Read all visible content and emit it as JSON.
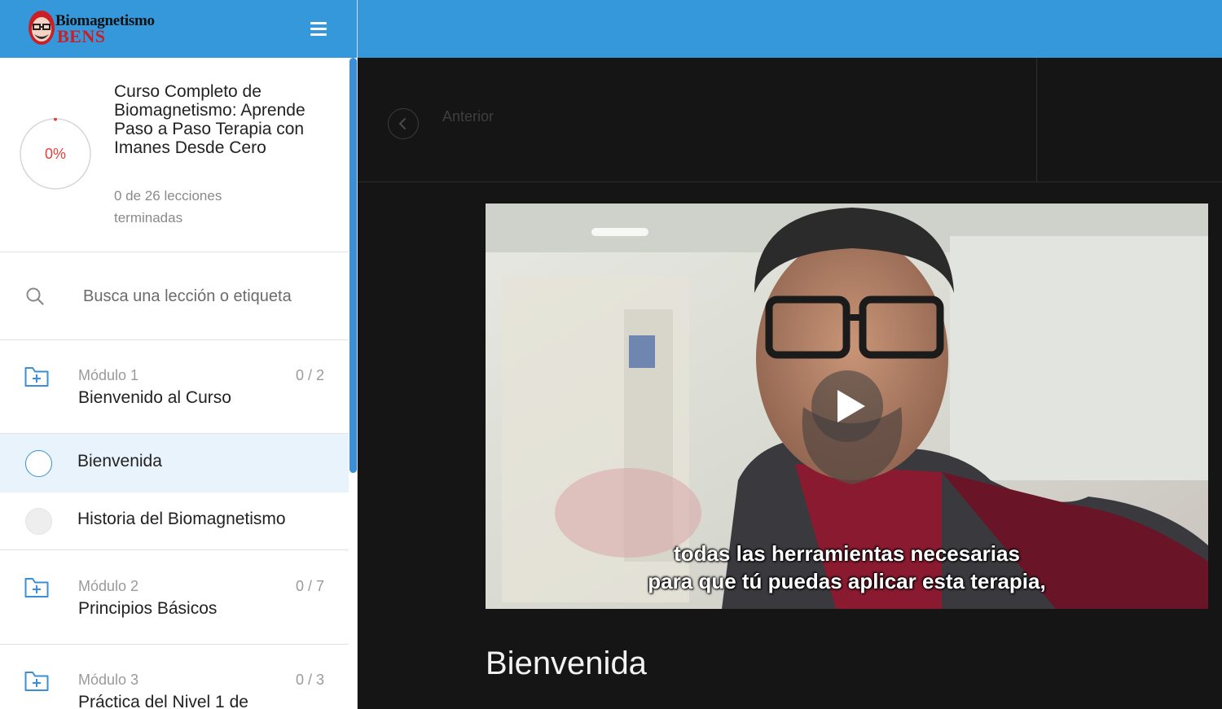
{
  "brand": {
    "line1": "Biomagnetismo",
    "line2": "BENS",
    "header_color": "#3498db",
    "accent_red": "#e0403a"
  },
  "course": {
    "progress_percent": "0%",
    "progress_value": 0,
    "title": "Curso Completo de Biomagnetismo: Aprende Paso a Paso Terapia con Imanes Desde Cero",
    "lessons_done": "0 de 26 lecciones terminadas"
  },
  "search": {
    "placeholder": "Busca una lección o etiqueta",
    "icon": "search-icon"
  },
  "modules": [
    {
      "number": "Módulo 1",
      "title": "Bienvenido al Curso",
      "count": "0 / 2",
      "icon": "folder-plus-icon"
    },
    {
      "number": "Módulo 2",
      "title": "Principios Básicos",
      "count": "0 / 7",
      "icon": "folder-plus-icon"
    },
    {
      "number": "Módulo 3",
      "title": "Práctica del Nivel 1 de",
      "count": "0 / 3",
      "icon": "folder-plus-icon"
    }
  ],
  "lessons": [
    {
      "title": "Bienvenida",
      "active": true
    },
    {
      "title": "Historia del Biomagnetismo",
      "active": false
    }
  ],
  "navigation": {
    "previous_label": "Anterior",
    "previous_icon": "chevron-left-icon"
  },
  "video": {
    "subtitle_line1": "todas las herramientas necesarias",
    "subtitle_line2": "para que tú puedas aplicar esta terapia,",
    "play_icon": "play-icon"
  },
  "lesson_heading": "Bienvenida"
}
